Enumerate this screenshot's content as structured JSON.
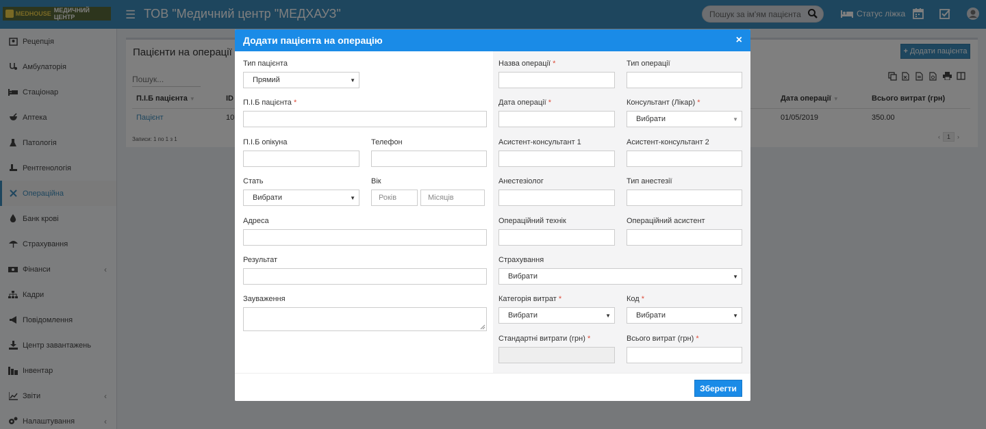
{
  "header": {
    "logo_brand": "MEDHOUSE",
    "logo_center": "МЕДИЧНИЙ ЦЕНТР",
    "title": "ТОВ \"Медичний центр \"МЕДХАУЗ\"",
    "search_placeholder": "Пошук за ім'ям пацієнта",
    "bed_status": "Статус ліжка"
  },
  "sidebar": {
    "items": [
      {
        "label": "Рецепція",
        "icon": "reception-icon"
      },
      {
        "label": "Амбулаторія",
        "icon": "stethoscope-icon"
      },
      {
        "label": "Стаціонар",
        "icon": "bed-icon"
      },
      {
        "label": "Аптека",
        "icon": "mortar-icon"
      },
      {
        "label": "Патологія",
        "icon": "flask-icon"
      },
      {
        "label": "Рентгенологія",
        "icon": "xray-icon"
      },
      {
        "label": "Операційна",
        "icon": "scissors-icon"
      },
      {
        "label": "Банк крові",
        "icon": "drop-icon"
      },
      {
        "label": "Страхування",
        "icon": "umbrella-icon"
      },
      {
        "label": "Фінанси",
        "icon": "money-icon"
      },
      {
        "label": "Кадри",
        "icon": "sitemap-icon"
      },
      {
        "label": "Повідомлення",
        "icon": "bullhorn-icon"
      },
      {
        "label": "Центр завантажень",
        "icon": "download-icon"
      },
      {
        "label": "Інвентар",
        "icon": "inventory-icon"
      },
      {
        "label": "Звіти",
        "icon": "chart-icon"
      },
      {
        "label": "Налаштування",
        "icon": "cogs-icon"
      }
    ]
  },
  "content": {
    "title": "Пацієнти на операції",
    "add_button": "Додати пацієнта",
    "filter_placeholder": "Пошук...",
    "columns": [
      "П.І.Б пацієнта",
      "ID",
      "Дата операції",
      "Всього витрат (грн)"
    ],
    "row": {
      "patient": "Пацієнт",
      "id": "10",
      "date": "01/05/2019",
      "total": "350.00"
    },
    "info": "Записи: 1 по 1 з 1",
    "page": "1"
  },
  "modal": {
    "title": "Додати пацієнта на операцію",
    "close": "×",
    "left": {
      "patient_type_label": "Тип пацієнта",
      "patient_type_value": "Прямий",
      "patient_name_label": "П.І.Б пацієнта",
      "guardian_label": "П.І.Б опікуна",
      "phone_label": "Телефон",
      "sex_label": "Стать",
      "sex_value": "Вибрати",
      "age_label": "Вік",
      "years_placeholder": "Років",
      "months_placeholder": "Місяців",
      "address_label": "Адреса",
      "result_label": "Результат",
      "remarks_label": "Зауваження"
    },
    "right": {
      "op_name_label": "Назва операції",
      "op_type_label": "Тип операції",
      "op_date_label": "Дата операції",
      "consultant_label": "Консультант (Лікар)",
      "consultant_value": "Вибрати",
      "assistant1_label": "Асистент-консультант 1",
      "assistant2_label": "Асистент-консультант 2",
      "anesthesiologist_label": "Анестезіолог",
      "anesthesia_type_label": "Тип анестезії",
      "op_technician_label": "Операційний технік",
      "op_assistant_label": "Операційний асистент",
      "insurance_label": "Страхування",
      "insurance_value": "Вибрати",
      "cost_category_label": "Категорія витрат",
      "cost_category_value": "Вибрати",
      "code_label": "Код",
      "code_value": "Вибрати",
      "standard_cost_label": "Стандартні витрати (грн)",
      "total_cost_label": "Всього витрат (грн)"
    },
    "required_mark": "*",
    "save_button": "Зберегти"
  }
}
